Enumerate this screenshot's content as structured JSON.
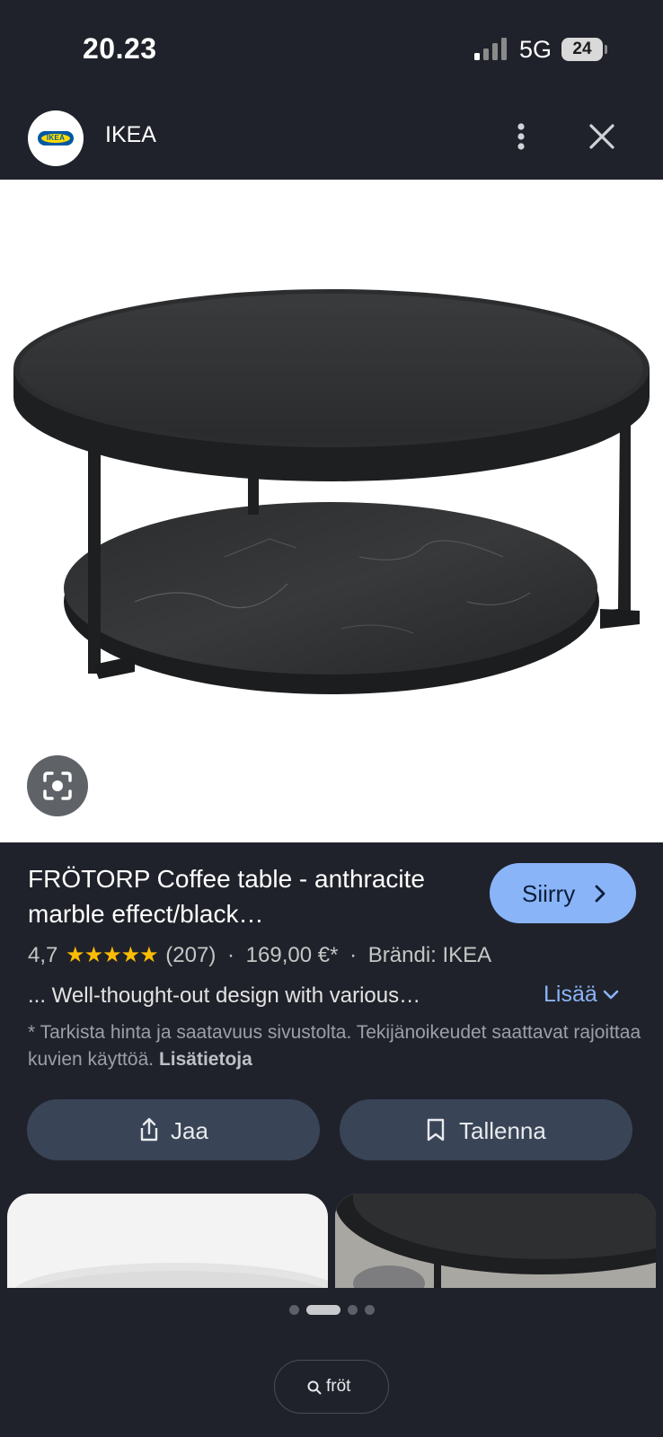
{
  "status_bar": {
    "time": "20.23",
    "network": "5G",
    "battery": "24"
  },
  "header": {
    "site_name": "IKEA",
    "logo_text": "IKEA"
  },
  "product": {
    "title": "FRÖTORP Coffee table - anthracite marble effect/black…",
    "goto_label": "Siirry",
    "rating": "4,7",
    "stars": "★★★★★",
    "review_count": "(207)",
    "price": "169,00 €*",
    "brand": "Brändi: IKEA",
    "description": "... Well-thought-out design with various…",
    "more_label": "Lisää",
    "disclaimer_text": "* Tarkista hinta ja saatavuus sivustolta. Tekijänoikeudet saattavat rajoittaa kuvien käyttöä.",
    "disclaimer_link": "Lisätietoja"
  },
  "actions": {
    "share_label": "Jaa",
    "save_label": "Tallenna"
  },
  "search": {
    "query": "fröt"
  },
  "colors": {
    "accent": "#8ab4f8",
    "background": "#20222b",
    "button": "#394457",
    "star": "#fbbc04"
  },
  "icons": [
    "ikea-logo",
    "more-vert-icon",
    "close-icon",
    "lens-icon",
    "chevron-right-icon",
    "chevron-down-icon",
    "share-icon",
    "bookmark-icon",
    "search-icon"
  ]
}
